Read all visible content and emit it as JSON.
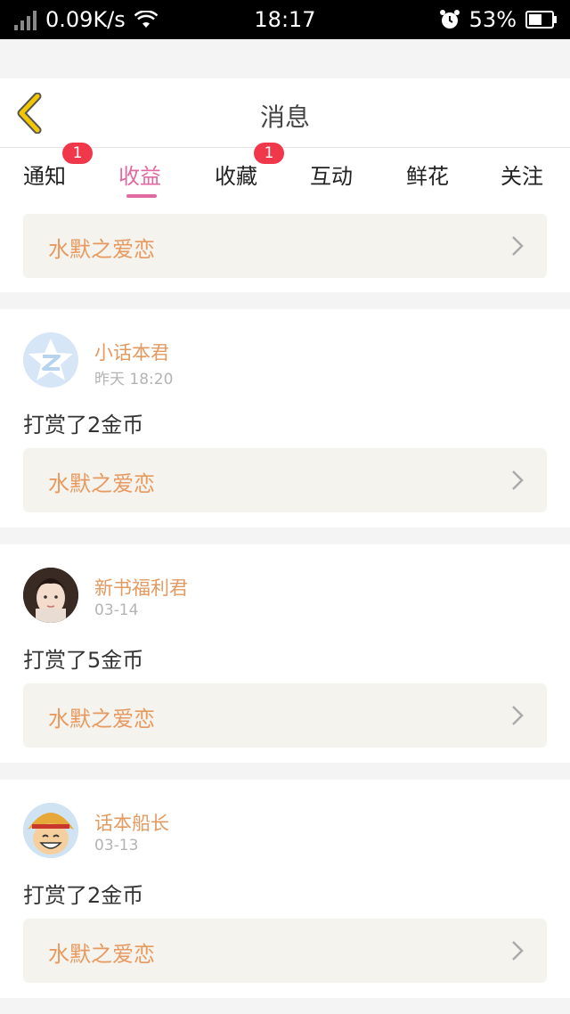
{
  "status_bar": {
    "network_speed": "0.09K/s",
    "time": "18:17",
    "battery": "53%",
    "icons": [
      "signal-icon",
      "wifi-icon",
      "alarm-icon",
      "battery-icon"
    ]
  },
  "header": {
    "title": "消息",
    "back_icon": "chevron-left-icon"
  },
  "tabs": [
    {
      "label": "通知",
      "badge": "1"
    },
    {
      "label": "收益",
      "active": true
    },
    {
      "label": "收藏",
      "badge": "1"
    },
    {
      "label": "互动"
    },
    {
      "label": "鲜花"
    },
    {
      "label": "关注"
    }
  ],
  "top_book": {
    "title": "水默之爱恋"
  },
  "items": [
    {
      "user": "小话本君",
      "date": "昨天 18:20",
      "message": "打赏了2金币",
      "book": "水默之爱恋",
      "avatar": "app-logo-avatar"
    },
    {
      "user": "新书福利君",
      "date": "03-14",
      "message": "打赏了5金币",
      "book": "水默之爱恋",
      "avatar": "girl-photo-avatar"
    },
    {
      "user": "话本船长",
      "date": "03-13",
      "message": "打赏了2金币",
      "book": "水默之爱恋",
      "avatar": "cartoon-captain-avatar"
    }
  ],
  "colors": {
    "accent_pink": "#e06aa1",
    "name_orange": "#e39a60",
    "badge_red": "#f0384a",
    "back_yellow": "#f2c700"
  }
}
